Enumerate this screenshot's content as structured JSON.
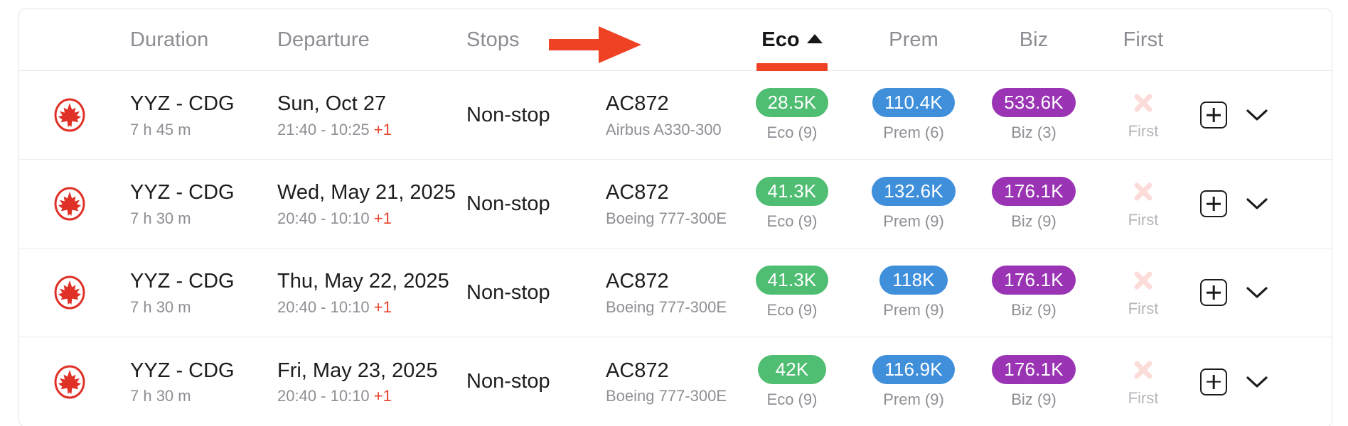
{
  "table": {
    "columns": {
      "airline": "",
      "duration": "Duration",
      "departure": "Departure",
      "stops": "Stops",
      "flight": "",
      "eco": "Eco",
      "prem": "Prem",
      "biz": "Biz",
      "first": "First",
      "actions": ""
    },
    "sort": {
      "column": "Eco",
      "direction": "ascending",
      "indicator_icon": "sort-ascending-caret-icon",
      "underline_color": "#ef4123"
    },
    "annotation": {
      "type": "red-arrow",
      "color": "#ef4123",
      "points_to": "Eco"
    },
    "colors": {
      "eco_badge": "#4fbd72",
      "prem_badge": "#3f8fdb",
      "biz_badge": "#9a34b5",
      "accent": "#ef4123",
      "plus_one": "#e8402a",
      "muted_text": "#8e8e95"
    },
    "rows": [
      {
        "airline_icon": "air-canada-maple-leaf-logo",
        "route": "YYZ - CDG",
        "duration": "7 h 45 m",
        "departure_date": "Sun, Oct 27",
        "departure_times": "21:40 - 10:25 ",
        "day_offset": "+1",
        "stops": "Non-stop",
        "flight_number": "AC872",
        "aircraft": "Airbus A330-300",
        "eco": {
          "points": "28.5K",
          "label": "Eco (9)",
          "available": true
        },
        "prem": {
          "points": "110.4K",
          "label": "Prem (6)",
          "available": true
        },
        "biz": {
          "points": "533.6K",
          "label": "Biz (3)",
          "available": true
        },
        "first": {
          "points": "",
          "label": "First",
          "available": false,
          "icon": "unavailable-x-icon"
        },
        "add_button_icon": "plus-square-icon",
        "expand_button_icon": "chevron-down-icon"
      },
      {
        "airline_icon": "air-canada-maple-leaf-logo",
        "route": "YYZ - CDG",
        "duration": "7 h 30 m",
        "departure_date": "Wed, May 21, 2025",
        "departure_times": "20:40 - 10:10 ",
        "day_offset": "+1",
        "stops": "Non-stop",
        "flight_number": "AC872",
        "aircraft": "Boeing 777-300E",
        "eco": {
          "points": "41.3K",
          "label": "Eco (9)",
          "available": true
        },
        "prem": {
          "points": "132.6K",
          "label": "Prem (9)",
          "available": true
        },
        "biz": {
          "points": "176.1K",
          "label": "Biz (9)",
          "available": true
        },
        "first": {
          "points": "",
          "label": "First",
          "available": false,
          "icon": "unavailable-x-icon"
        },
        "add_button_icon": "plus-square-icon",
        "expand_button_icon": "chevron-down-icon"
      },
      {
        "airline_icon": "air-canada-maple-leaf-logo",
        "route": "YYZ - CDG",
        "duration": "7 h 30 m",
        "departure_date": "Thu, May 22, 2025",
        "departure_times": "20:40 - 10:10 ",
        "day_offset": "+1",
        "stops": "Non-stop",
        "flight_number": "AC872",
        "aircraft": "Boeing 777-300E",
        "eco": {
          "points": "41.3K",
          "label": "Eco (9)",
          "available": true
        },
        "prem": {
          "points": "118K",
          "label": "Prem (9)",
          "available": true
        },
        "biz": {
          "points": "176.1K",
          "label": "Biz (9)",
          "available": true
        },
        "first": {
          "points": "",
          "label": "First",
          "available": false,
          "icon": "unavailable-x-icon"
        },
        "add_button_icon": "plus-square-icon",
        "expand_button_icon": "chevron-down-icon"
      },
      {
        "airline_icon": "air-canada-maple-leaf-logo",
        "route": "YYZ - CDG",
        "duration": "7 h 30 m",
        "departure_date": "Fri, May 23, 2025",
        "departure_times": "20:40 - 10:10 ",
        "day_offset": "+1",
        "stops": "Non-stop",
        "flight_number": "AC872",
        "aircraft": "Boeing 777-300E",
        "eco": {
          "points": "42K",
          "label": "Eco (9)",
          "available": true
        },
        "prem": {
          "points": "116.9K",
          "label": "Prem (9)",
          "available": true
        },
        "biz": {
          "points": "176.1K",
          "label": "Biz (9)",
          "available": true
        },
        "first": {
          "points": "",
          "label": "First",
          "available": false,
          "icon": "unavailable-x-icon"
        },
        "add_button_icon": "plus-square-icon",
        "expand_button_icon": "chevron-down-icon"
      }
    ]
  }
}
